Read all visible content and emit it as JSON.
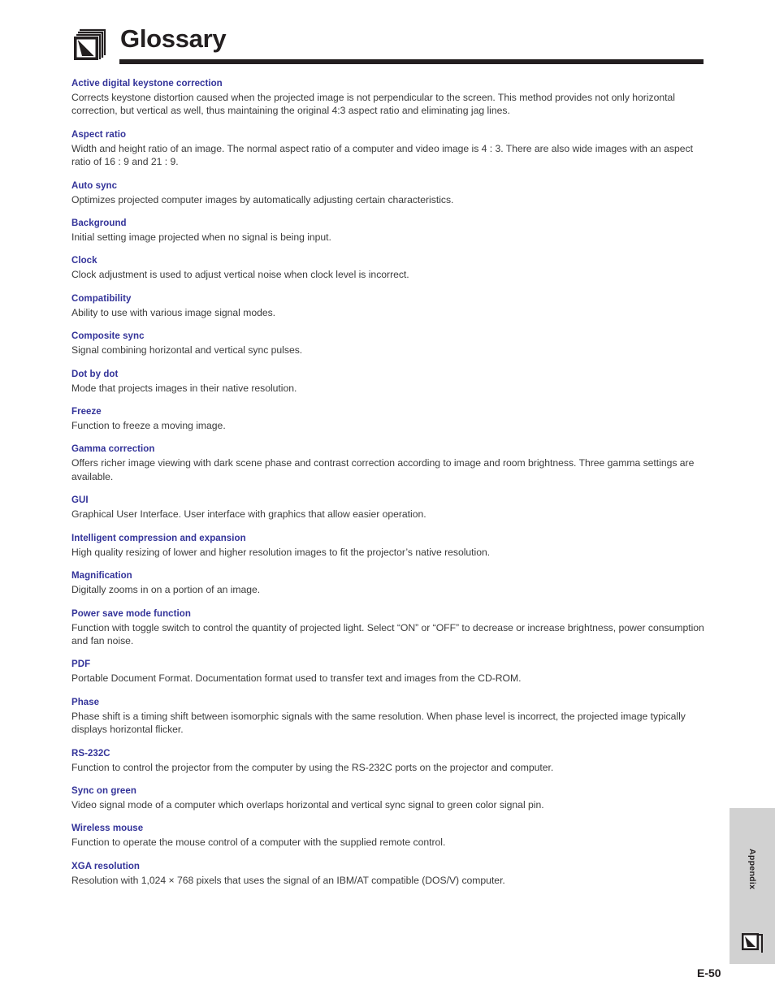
{
  "header": {
    "title": "Glossary",
    "icon": "pages-stack-cursor-icon"
  },
  "glossary": {
    "entries": [
      {
        "term": "Active digital keystone correction",
        "definition": "Corrects keystone distortion caused when the projected image is not perpendicular to the screen. This method provides not only horizontal correction, but vertical as well, thus maintaining the original 4:3 aspect ratio and eliminating jag lines."
      },
      {
        "term": "Aspect ratio",
        "definition": "Width and height ratio of an image. The normal aspect ratio of a computer and video image is 4 : 3. There are also wide images with an aspect ratio of 16 : 9 and 21 : 9."
      },
      {
        "term": "Auto sync",
        "definition": "Optimizes projected computer images by automatically adjusting certain characteristics."
      },
      {
        "term": "Background",
        "definition": "Initial setting image projected when no signal is being input."
      },
      {
        "term": "Clock",
        "definition": "Clock adjustment is used to adjust vertical noise when clock level is incorrect."
      },
      {
        "term": "Compatibility",
        "definition": "Ability to use with various image signal modes."
      },
      {
        "term": "Composite sync",
        "definition": "Signal combining horizontal and vertical sync pulses."
      },
      {
        "term": "Dot by dot",
        "definition": "Mode that projects images in their native resolution."
      },
      {
        "term": "Freeze",
        "definition": "Function to freeze a moving image."
      },
      {
        "term": "Gamma correction",
        "definition": "Offers richer image viewing with dark scene phase and contrast correction according to image and room brightness. Three gamma settings are available."
      },
      {
        "term": "GUI",
        "definition": "Graphical User Interface. User interface with graphics that allow easier operation."
      },
      {
        "term": "Intelligent compression and expansion",
        "definition": "High quality resizing of lower and higher resolution images to fit the projector’s native resolution."
      },
      {
        "term": "Magnification",
        "definition": "Digitally zooms in on a portion of an image."
      },
      {
        "term": "Power save mode function",
        "definition": "Function with toggle switch to control the quantity of projected light. Select “ON” or “OFF” to decrease or increase brightness, power consumption and fan noise."
      },
      {
        "term": "PDF",
        "definition": "Portable Document Format. Documentation format used to transfer text and images from the CD-ROM."
      },
      {
        "term": "Phase",
        "definition": "Phase shift is a timing shift between isomorphic signals with the same resolution. When phase level is incorrect, the projected image typically displays horizontal flicker."
      },
      {
        "term": "RS-232C",
        "definition": "Function to control the projector from the computer by using the RS-232C ports on the projector and computer."
      },
      {
        "term": "Sync on green",
        "definition": "Video signal mode of a computer which overlaps horizontal and vertical sync signal to green color signal pin."
      },
      {
        "term": "Wireless mouse",
        "definition": "Function to operate the mouse control of a computer with the supplied remote control."
      },
      {
        "term": "XGA resolution",
        "definition": "Resolution with 1,024 × 768 pixels that uses the signal of an IBM/AT compatible (DOS/V) computer."
      }
    ]
  },
  "side_tab": {
    "label": "Appendix",
    "icon": "page-corner-cursor-icon",
    "background_color": "#d1d1d1"
  },
  "footer": {
    "page_number": "E-50"
  },
  "colors": {
    "term_blue": "#333399",
    "body_gray": "#3b3b3b",
    "ink_black": "#231f20"
  }
}
